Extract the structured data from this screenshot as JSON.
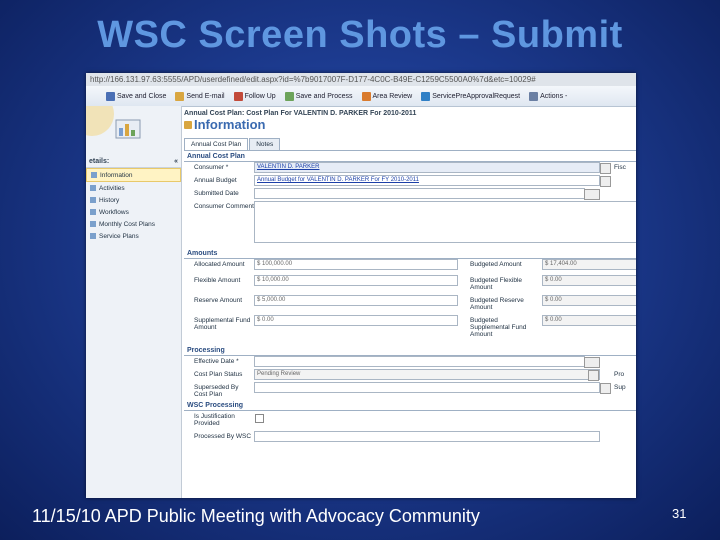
{
  "slide": {
    "title": "WSC Screen Shots – Submit",
    "footer": "11/15/10 APD Public Meeting with Advocacy Community",
    "page_number": "31"
  },
  "browser": {
    "url": "http://166.131.97.63:5555/APD/userdefined/edit.aspx?id=%7b9017007F-D177-4C0C-B49E-C1259C5500A0%7d&etc=10029#"
  },
  "toolbar": {
    "save_close": "Save and Close",
    "send_email": "Send E-mail",
    "follow_up": "Follow Up",
    "save_process": "Save and Process",
    "area_review": "Area Review",
    "service_preapproval": "ServicePreApprovalRequest",
    "actions": "Actions -"
  },
  "sidebar": {
    "header": "etails:",
    "items": [
      "Information",
      "Activities",
      "History",
      "Workflows",
      "Monthly Cost Plans",
      "Service Plans"
    ]
  },
  "form": {
    "breadcrumb": "Annual Cost Plan: Cost Plan For VALENTIN D. PARKER For 2010-2011",
    "heading": "Information",
    "tabs": [
      "Annual Cost Plan",
      "Notes"
    ],
    "sections": {
      "plan": "Annual Cost Plan",
      "amounts": "Amounts",
      "processing": "Processing",
      "wsc": "WSC Processing"
    },
    "labels": {
      "consumer": "Consumer *",
      "annual_budget": "Annual Budget",
      "submitted_date": "Submitted Date",
      "consumer_comments": "Consumer Comments",
      "allocated": "Allocated Amount",
      "flexible": "Flexible Amount",
      "reserve": "Reserve Amount",
      "supplemental": "Supplemental Fund Amount",
      "budgeted": "Budgeted Amount",
      "budgeted_flexible": "Budgeted Flexible Amount",
      "budgeted_reserve": "Budgeted Reserve Amount",
      "budgeted_supplemental": "Budgeted Supplemental Fund Amount",
      "effective_date": "Effective Date *",
      "status": "Cost Plan Status",
      "superseded": "Superseded By Cost Plan",
      "justification": "Is Justification Provided",
      "processed_by": "Processed By WSC"
    },
    "values": {
      "consumer": "VALENTIN D. PARKER",
      "annual_budget": "Annual Budget for VALENTIN D. PARKER For FY 2010-2011",
      "allocated": "$ 100,000.00",
      "flexible": "$ 10,000.00",
      "reserve": "$ 5,000.00",
      "supplemental": "$ 0.00",
      "budgeted": "$ 17,404.00",
      "budgeted_flexible": "$ 0.00",
      "budgeted_reserve": "$ 0.00",
      "budgeted_supplemental": "$ 0.00",
      "status": "Pending Review"
    },
    "right_cut": {
      "fisc": "Fisc",
      "pro": "Pro",
      "sup": "Sup"
    }
  }
}
